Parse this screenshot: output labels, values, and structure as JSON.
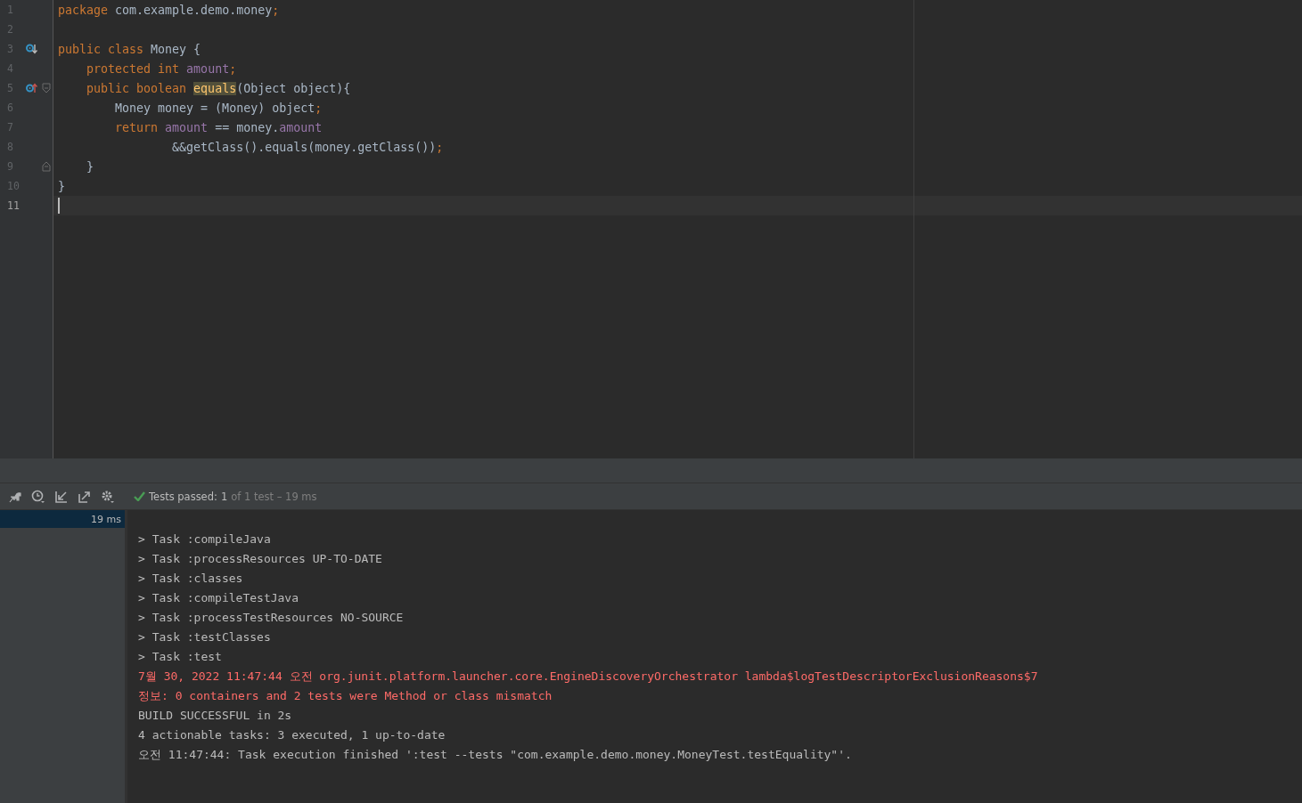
{
  "editor": {
    "lines": [
      {
        "number": "1",
        "current": false,
        "tokens": [
          {
            "text": "package",
            "kind": "keyword"
          },
          {
            "text": " com.example.demo.money",
            "kind": "plain"
          },
          {
            "text": ";",
            "kind": "keyword"
          }
        ]
      },
      {
        "number": "2",
        "current": false
      },
      {
        "number": "3",
        "current": false,
        "gutter_icon": {
          "kind": "implemented"
        },
        "tokens": [
          {
            "text": "public class ",
            "kind": "keyword"
          },
          {
            "text": "Money {",
            "kind": "plain"
          }
        ]
      },
      {
        "number": "4",
        "current": false,
        "tokens": [
          {
            "text": "    protected int ",
            "kind": "keyword"
          },
          {
            "text": "amount",
            "kind": "field"
          },
          {
            "text": ";",
            "kind": "keyword"
          }
        ]
      },
      {
        "number": "5",
        "current": false,
        "gutter_icon": {
          "kind": "overrides"
        },
        "fold": {
          "kind": "start"
        },
        "tokens": [
          {
            "text": "    public boolean ",
            "kind": "keyword"
          },
          {
            "text": "equals",
            "kind": "highlight"
          },
          {
            "text": "(Object object){",
            "kind": "plain"
          }
        ]
      },
      {
        "number": "6",
        "current": false,
        "tokens": [
          {
            "text": "        Money money = (Money) object",
            "kind": "plain"
          },
          {
            "text": ";",
            "kind": "keyword"
          }
        ]
      },
      {
        "number": "7",
        "current": false,
        "tokens": [
          {
            "text": "        return ",
            "kind": "keyword"
          },
          {
            "text": "amount",
            "kind": "field"
          },
          {
            "text": " == money.",
            "kind": "plain"
          },
          {
            "text": "amount",
            "kind": "field"
          }
        ]
      },
      {
        "number": "8",
        "current": false,
        "tokens": [
          {
            "text": "                &&getClass().equals(money.getClass())",
            "kind": "plain"
          },
          {
            "text": ";",
            "kind": "keyword"
          }
        ]
      },
      {
        "number": "9",
        "current": false,
        "fold": {
          "kind": "end"
        },
        "tokens": [
          {
            "text": "    }",
            "kind": "plain"
          }
        ]
      },
      {
        "number": "10",
        "current": false,
        "tokens": [
          {
            "text": "}",
            "kind": "plain"
          }
        ]
      },
      {
        "number": "11",
        "current": true
      }
    ]
  },
  "run_panel": {
    "status": {
      "passed": true,
      "label": "Tests passed:",
      "count": "1",
      "detail": "of 1 test – 19 ms"
    },
    "tree": [
      {
        "duration": "19 ms",
        "selected": true
      }
    ],
    "console": [
      {
        "text": "> Task :compileJava",
        "kind": "normal"
      },
      {
        "text": "> Task :processResources UP-TO-DATE",
        "kind": "normal"
      },
      {
        "text": "> Task :classes",
        "kind": "normal"
      },
      {
        "text": "> Task :compileTestJava",
        "kind": "normal"
      },
      {
        "text": "> Task :processTestResources NO-SOURCE",
        "kind": "normal"
      },
      {
        "text": "> Task :testClasses",
        "kind": "normal"
      },
      {
        "text": "> Task :test",
        "kind": "normal"
      },
      {
        "text": "7월 30, 2022 11:47:44 오전 org.junit.platform.launcher.core.EngineDiscoveryOrchestrator lambda$logTestDescriptorExclusionReasons$7",
        "kind": "error"
      },
      {
        "text": "정보: 0 containers and 2 tests were Method or class mismatch",
        "kind": "error"
      },
      {
        "text": "BUILD SUCCESSFUL in 2s",
        "kind": "normal"
      },
      {
        "text": "4 actionable tasks: 3 executed, 1 up-to-date",
        "kind": "normal"
      },
      {
        "text": "오전 11:47:44: Task execution finished ':test --tests \"com.example.demo.money.MoneyTest.testEquality\"'.",
        "kind": "normal"
      }
    ]
  }
}
